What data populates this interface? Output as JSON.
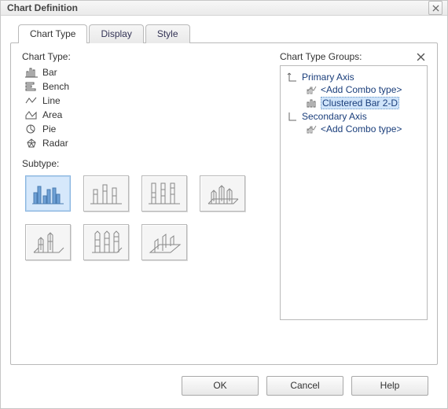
{
  "window": {
    "title": "Chart Definition"
  },
  "tabs": {
    "chart_type": "Chart Type",
    "display": "Display",
    "style": "Style"
  },
  "left": {
    "chart_type_label": "Chart Type:",
    "types": {
      "bar": "Bar",
      "bench": "Bench",
      "line": "Line",
      "area": "Area",
      "pie": "Pie",
      "radar": "Radar"
    },
    "subtype_label": "Subtype:"
  },
  "right": {
    "group_label": "Chart Type Groups:",
    "primary_axis": "Primary Axis",
    "add_combo_1": "<Add Combo type>",
    "clustered_bar": "Clustered Bar 2-D",
    "secondary_axis": "Secondary Axis",
    "add_combo_2": "<Add Combo type>"
  },
  "buttons": {
    "ok": "OK",
    "cancel": "Cancel",
    "help": "Help"
  }
}
